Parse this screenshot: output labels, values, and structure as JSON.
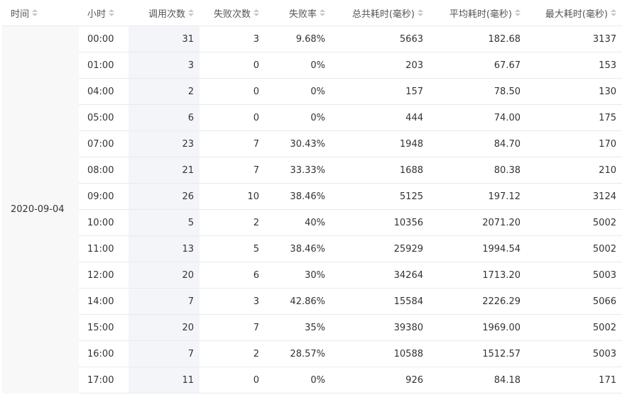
{
  "columns": {
    "time": "时间",
    "hour": "小时",
    "calls": "调用次数",
    "fails": "失败次数",
    "fail_rate": "失败率",
    "total_ms": "总共耗时(毫秒)",
    "avg_ms": "平均耗时(毫秒)",
    "max_ms": "最大耗时(毫秒)"
  },
  "date": "2020-09-04",
  "rows": [
    {
      "hour": "00:00",
      "calls": "31",
      "fails": "3",
      "fail_rate": "9.68%",
      "total_ms": "5663",
      "avg_ms": "182.68",
      "max_ms": "3137"
    },
    {
      "hour": "01:00",
      "calls": "3",
      "fails": "0",
      "fail_rate": "0%",
      "total_ms": "203",
      "avg_ms": "67.67",
      "max_ms": "153"
    },
    {
      "hour": "04:00",
      "calls": "2",
      "fails": "0",
      "fail_rate": "0%",
      "total_ms": "157",
      "avg_ms": "78.50",
      "max_ms": "130"
    },
    {
      "hour": "05:00",
      "calls": "6",
      "fails": "0",
      "fail_rate": "0%",
      "total_ms": "444",
      "avg_ms": "74.00",
      "max_ms": "175"
    },
    {
      "hour": "07:00",
      "calls": "23",
      "fails": "7",
      "fail_rate": "30.43%",
      "total_ms": "1948",
      "avg_ms": "84.70",
      "max_ms": "170"
    },
    {
      "hour": "08:00",
      "calls": "21",
      "fails": "7",
      "fail_rate": "33.33%",
      "total_ms": "1688",
      "avg_ms": "80.38",
      "max_ms": "210"
    },
    {
      "hour": "09:00",
      "calls": "26",
      "fails": "10",
      "fail_rate": "38.46%",
      "total_ms": "5125",
      "avg_ms": "197.12",
      "max_ms": "3124"
    },
    {
      "hour": "10:00",
      "calls": "5",
      "fails": "2",
      "fail_rate": "40%",
      "total_ms": "10356",
      "avg_ms": "2071.20",
      "max_ms": "5002"
    },
    {
      "hour": "11:00",
      "calls": "13",
      "fails": "5",
      "fail_rate": "38.46%",
      "total_ms": "25929",
      "avg_ms": "1994.54",
      "max_ms": "5002"
    },
    {
      "hour": "12:00",
      "calls": "20",
      "fails": "6",
      "fail_rate": "30%",
      "total_ms": "34264",
      "avg_ms": "1713.20",
      "max_ms": "5003"
    },
    {
      "hour": "14:00",
      "calls": "7",
      "fails": "3",
      "fail_rate": "42.86%",
      "total_ms": "15584",
      "avg_ms": "2226.29",
      "max_ms": "5066"
    },
    {
      "hour": "15:00",
      "calls": "20",
      "fails": "7",
      "fail_rate": "35%",
      "total_ms": "39380",
      "avg_ms": "1969.00",
      "max_ms": "5002"
    },
    {
      "hour": "16:00",
      "calls": "7",
      "fails": "2",
      "fail_rate": "28.57%",
      "total_ms": "10588",
      "avg_ms": "1512.57",
      "max_ms": "5003"
    },
    {
      "hour": "17:00",
      "calls": "11",
      "fails": "0",
      "fail_rate": "0%",
      "total_ms": "926",
      "avg_ms": "84.18",
      "max_ms": "171"
    }
  ],
  "icons": {
    "sort": "sort-icon"
  },
  "colors": {
    "header_text": "#555555",
    "date_bg": "#f8f8f9",
    "calls_bg": "#f3f5f8",
    "border": "#e8eaec"
  }
}
